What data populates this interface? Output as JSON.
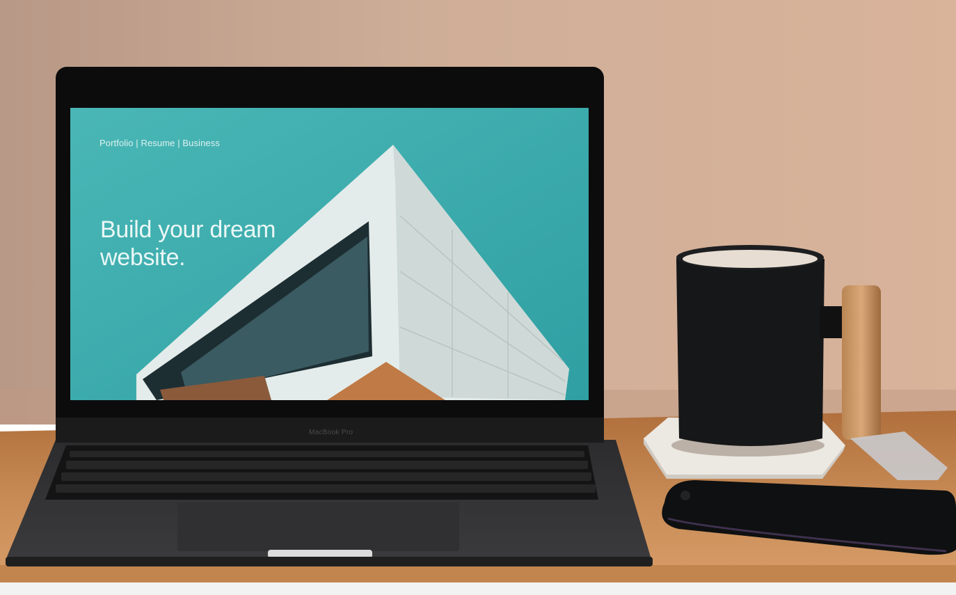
{
  "screen": {
    "nav_links": "Portfolio | Resume | Business",
    "headline": {
      "line1": "Build your dream",
      "line2": "website."
    }
  },
  "laptop": {
    "brand_label": "MacBook Pro"
  },
  "colors": {
    "wall": "#c9a48d",
    "screen_teal": "#3aa8a8",
    "desk_wood": "#a8683a",
    "laptop_body": "#2a2a2b",
    "mug": "#161718"
  }
}
